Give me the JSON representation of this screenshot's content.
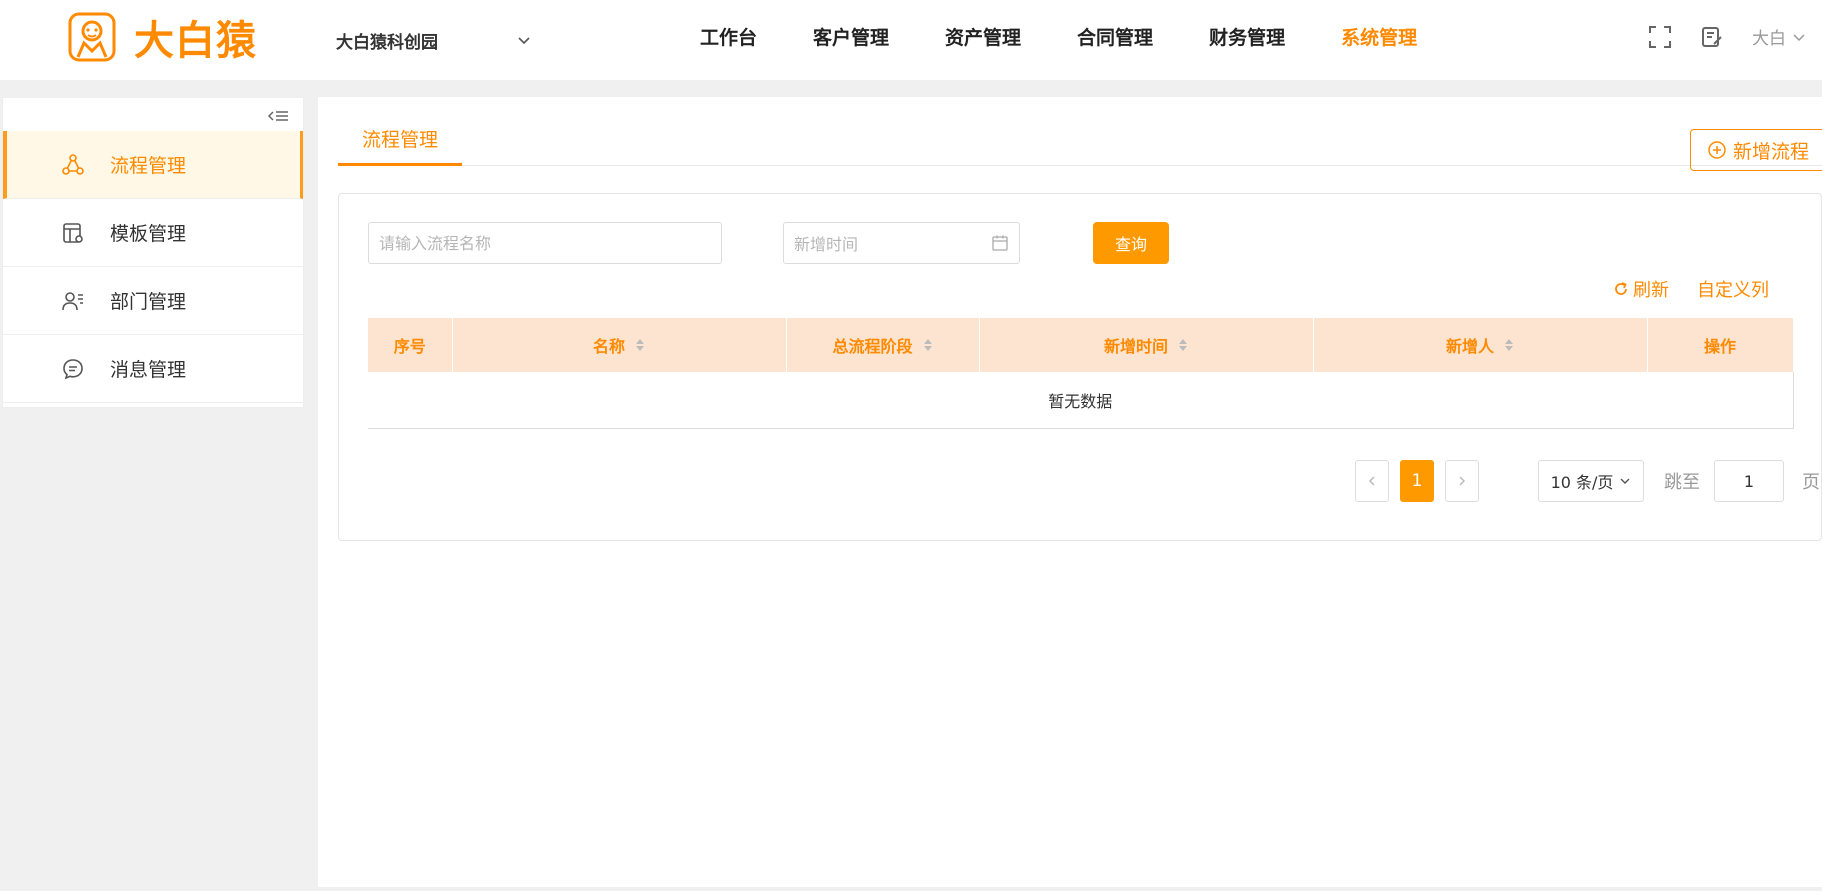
{
  "header": {
    "logo_text": "大白猿",
    "company_selector": "大白猿科创园",
    "nav": [
      {
        "label": "工作台",
        "active": false
      },
      {
        "label": "客户管理",
        "active": false
      },
      {
        "label": "资产管理",
        "active": false
      },
      {
        "label": "合同管理",
        "active": false
      },
      {
        "label": "财务管理",
        "active": false
      },
      {
        "label": "系统管理",
        "active": true
      }
    ],
    "user_name": "大白"
  },
  "sidebar": {
    "items": [
      {
        "label": "流程管理",
        "icon": "flow-icon",
        "active": true
      },
      {
        "label": "模板管理",
        "icon": "template-icon",
        "active": false
      },
      {
        "label": "部门管理",
        "icon": "department-icon",
        "active": false
      },
      {
        "label": "消息管理",
        "icon": "message-icon",
        "active": false
      }
    ]
  },
  "main": {
    "tab_label": "流程管理",
    "add_button": "新增流程",
    "search": {
      "name_placeholder": "请输入流程名称",
      "date_placeholder": "新增时间",
      "query_button": "查询"
    },
    "toolbar": {
      "refresh": "刷新",
      "custom_columns": "自定义列"
    },
    "table": {
      "columns": [
        "序号",
        "名称",
        "总流程阶段",
        "新增时间",
        "新增人",
        "操作"
      ],
      "empty_text": "暂无数据"
    },
    "pagination": {
      "current_page": "1",
      "page_size": "10 条/页",
      "jump_label": "跳至",
      "jump_value": "1",
      "page_suffix": "页"
    }
  },
  "colors": {
    "accent": "#ff8a00",
    "button": "#ff9900",
    "table_header_bg": "#fde4d0",
    "active_menu_bg": "#fff8e6"
  }
}
